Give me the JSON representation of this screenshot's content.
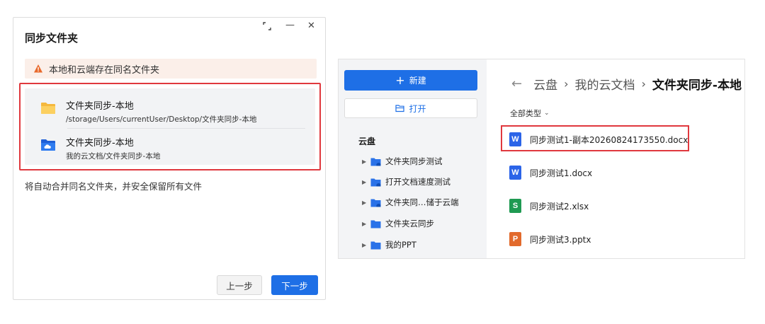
{
  "colors": {
    "accent": "#1e6fe6",
    "highlight": "#e0383e",
    "warning_bg": "#fbefe9",
    "warning_icon": "#e8692b",
    "word": "#2b64e8",
    "excel": "#1f9a52",
    "ppt": "#e26a2c"
  },
  "dialog": {
    "title": "同步文件夹",
    "controls": {
      "restore": "⌜⌟",
      "minimize": "—",
      "close": "✕"
    },
    "warning": {
      "icon": "warning-icon",
      "text": "本地和云端存在同名文件夹"
    },
    "folders": [
      {
        "icon": "local-folder-icon",
        "name": "文件夹同步-本地",
        "path": "/storage/Users/currentUser/Desktop/文件夹同步-本地"
      },
      {
        "icon": "cloud-folder-icon",
        "name": "文件夹同步-本地",
        "path": "我的云文档/文件夹同步-本地"
      }
    ],
    "note": "将自动合并同名文件夹，并安全保留所有文件",
    "buttons": {
      "prev": "上一步",
      "next": "下一步"
    }
  },
  "explorer": {
    "sidebar": {
      "new_button": {
        "icon": "plus-icon",
        "label": "新建"
      },
      "open_button": {
        "icon": "open-folder-icon",
        "label": "打开"
      },
      "section_title": "云盘",
      "tree": [
        {
          "label": "文件夹同步测试",
          "icon": "sync-folder-icon"
        },
        {
          "label": "打开文档速度测试",
          "icon": "sync-folder-icon"
        },
        {
          "label": "文件夹同…储于云端",
          "icon": "sync-folder-icon"
        },
        {
          "label": "文件夹云同步",
          "icon": "folder-icon"
        },
        {
          "label": "我的PPT",
          "icon": "folder-icon"
        }
      ]
    },
    "breadcrumb": {
      "back": "←",
      "items": [
        "云盘",
        "我的云文档"
      ],
      "separator": "›",
      "current": "文件夹同步-本地"
    },
    "sort": {
      "label": "全部类型",
      "chevron": "⌄"
    },
    "files": [
      {
        "type": "word",
        "letter": "W",
        "name": "同步测试1-副本20260824173550.docx"
      },
      {
        "type": "word",
        "letter": "W",
        "name": "同步测试1.docx"
      },
      {
        "type": "excel",
        "letter": "S",
        "name": "同步测试2.xlsx"
      },
      {
        "type": "ppt",
        "letter": "P",
        "name": "同步测试3.pptx"
      }
    ]
  }
}
